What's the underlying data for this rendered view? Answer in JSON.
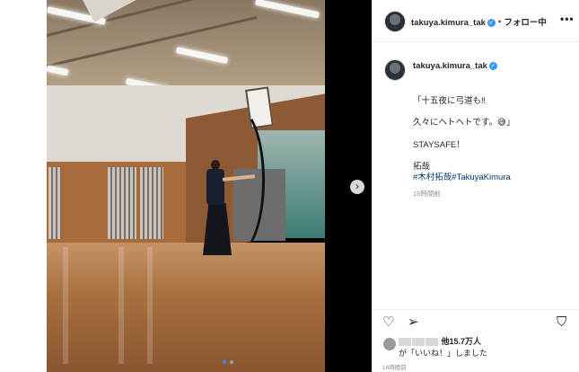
{
  "header": {
    "username": "takuya.kimura_tak",
    "follow_label": "・フォロー中",
    "more_icon": "more-horizontal-icon"
  },
  "caption": {
    "username": "takuya.kimura_tak",
    "lines": [
      "「十五夜に弓道も‼",
      "久々にヘトヘトです。😅」",
      "STAYSAFE！",
      "拓哉",
      "#木村拓哉#TakuyaKimura"
    ],
    "time": "16時間前"
  },
  "media": {
    "next_icon": "›",
    "dots": 2,
    "active_dot": 0
  },
  "actions": {
    "like_icon": "♡",
    "share_icon": "➢",
    "save_icon": "⛉"
  },
  "likes": {
    "count_text": "他15.7万人",
    "suffix_text": "が「いいね！」しました"
  },
  "post_time": "16時間前",
  "colors": {
    "accent": "#3897f0",
    "hashtag": "#00376b"
  }
}
